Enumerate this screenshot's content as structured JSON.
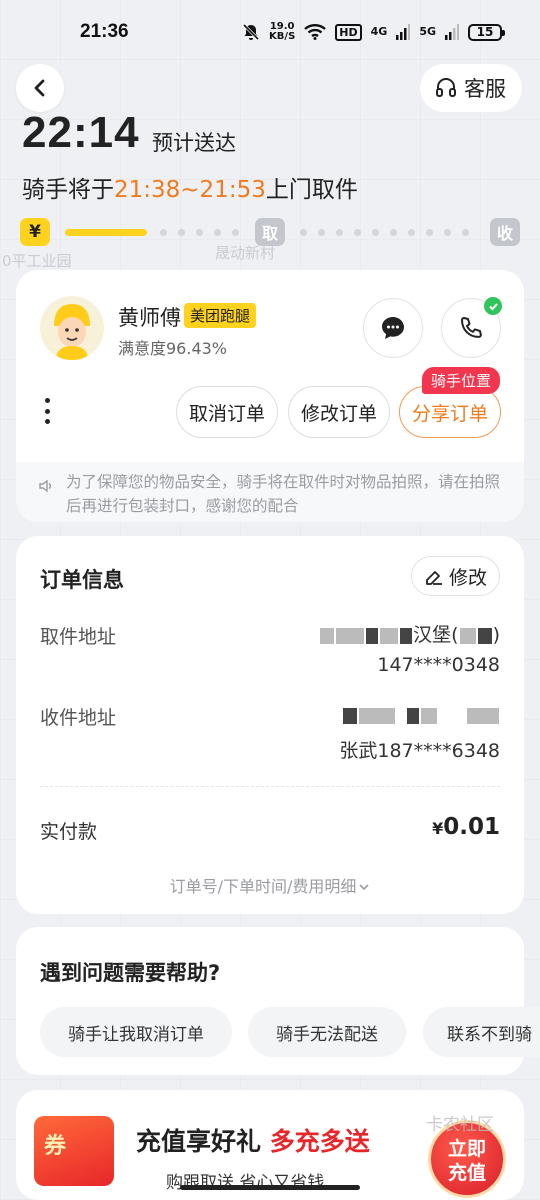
{
  "status_bar": {
    "time": "21:36",
    "net_speed_top": "19.0",
    "net_speed_bottom": "KB/S",
    "hd_label": "HD",
    "sig1_label": "4G",
    "sig2_label": "5G",
    "battery": "15"
  },
  "header": {
    "service_label": "客服",
    "eta_time": "22:14",
    "eta_label": "预计送达",
    "pickup_prefix": "骑手将于",
    "pickup_window": "21:38~21:53",
    "pickup_suffix": "上门取件"
  },
  "progress": {
    "start_icon": "¥",
    "pickup_node": "取",
    "receive_node": "收"
  },
  "rider": {
    "name": "黄师傅",
    "tag": "美团跑腿",
    "rating": "满意度96.43%",
    "position_tag": "骑手位置",
    "cancel_label": "取消订单",
    "modify_label": "修改订单",
    "share_label": "分享订单",
    "notice": "为了保障您的物品安全，骑手将在取件时对物品拍照，请在拍照后再进行包装封口，感谢您的配合"
  },
  "order": {
    "title": "订单信息",
    "edit_label": "修改",
    "pickup_label": "取件地址",
    "pickup_addr_visible": "汉堡(",
    "pickup_phone": "147****0348",
    "dest_label": "收件地址",
    "dest_contact": "张武187****6348",
    "paid_label": "实付款",
    "paid_currency": "¥",
    "paid_amount": "0.01",
    "detail_link": "订单号/下单时间/费用明细"
  },
  "help": {
    "title": "遇到问题需要帮助?",
    "chips": [
      "骑手让我取消订单",
      "骑手无法配送",
      "联系不到骑"
    ]
  },
  "promo": {
    "coupon": "券",
    "main_prefix": "充值享好礼",
    "main_red": "多充多送",
    "sub": "购跟取送 省心又省钱",
    "cta_line1": "立即",
    "cta_line2": "充值",
    "watermark": "卡农社区"
  },
  "map": {
    "labels": [
      "0平工业园",
      "晟动新村"
    ]
  },
  "colors": {
    "accent_yellow": "#ffd21f",
    "accent_orange": "#f07b1d",
    "badge_red": "#f1364d"
  }
}
